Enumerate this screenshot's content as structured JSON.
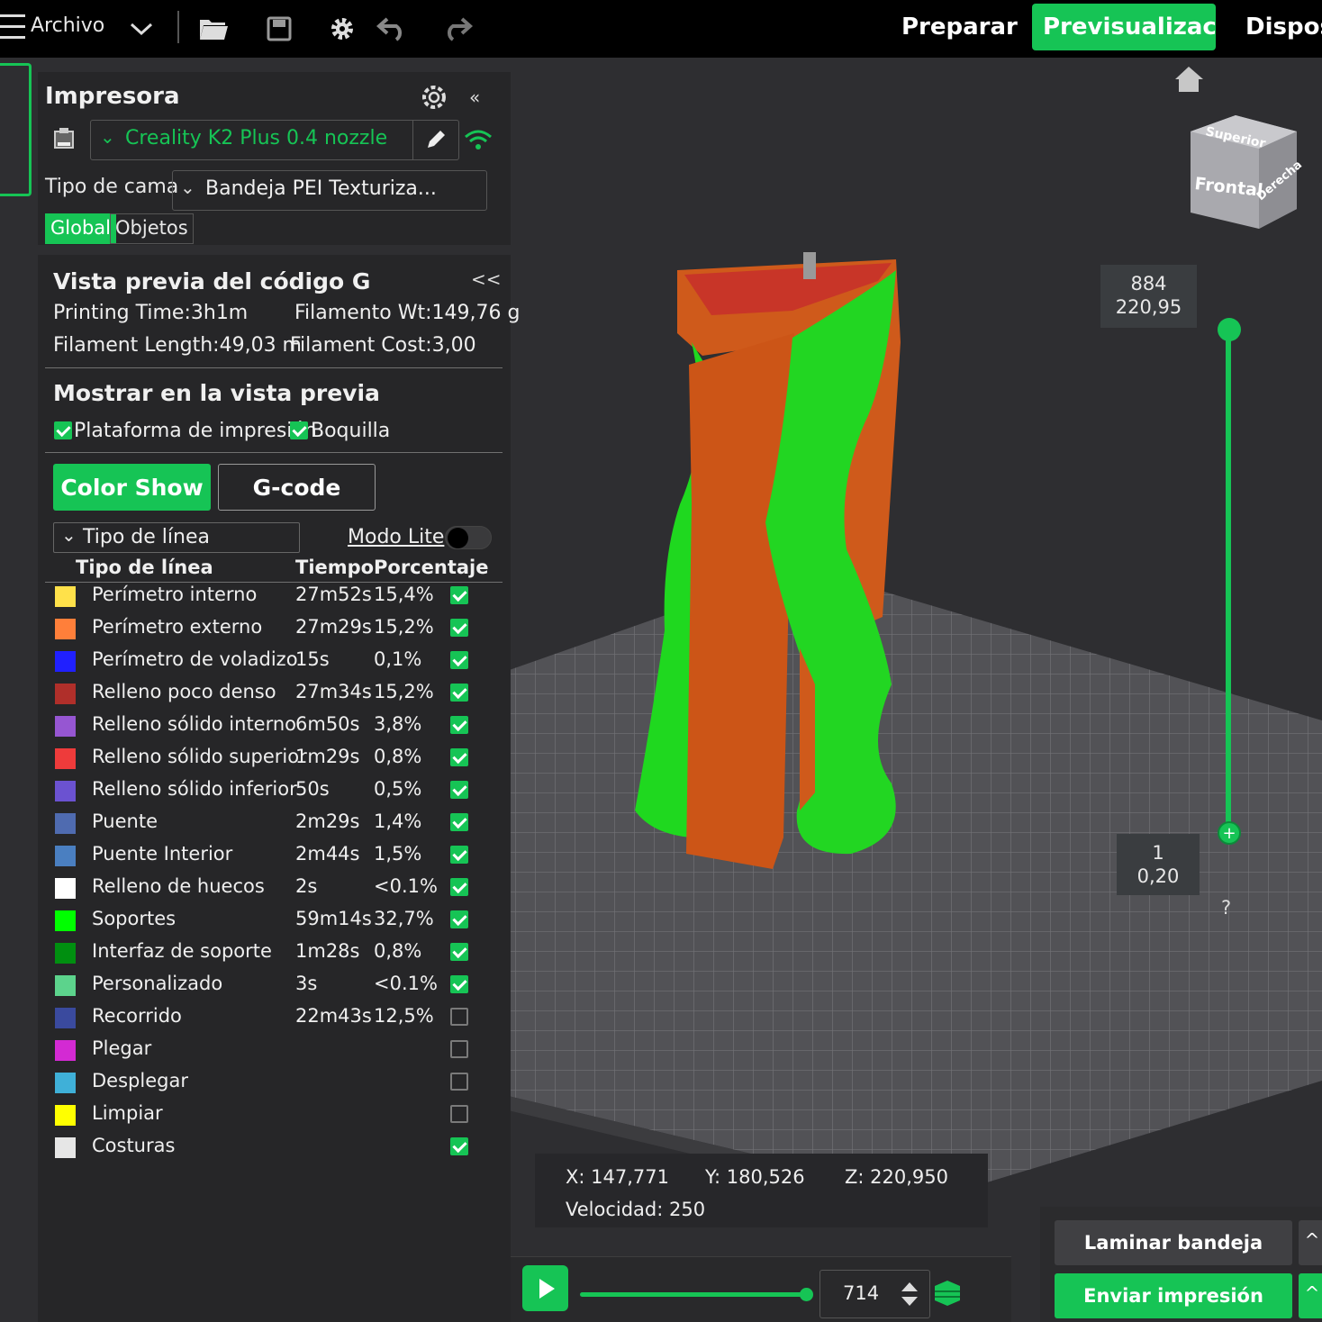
{
  "topbar": {
    "archivo": "Archivo",
    "tabs": [
      "Preparar",
      "Previsualización",
      "Dispositivo"
    ],
    "active_tab": "Previsualización"
  },
  "printer": {
    "title": "Impresora",
    "model": "Creality K2 Plus 0.4 nozzle",
    "bed_label": "Tipo de cama",
    "bed_value": "Bandeja PEI Texturiza...",
    "scope_tabs": [
      "Global",
      "Objetos"
    ]
  },
  "gcode": {
    "title": "Vista previa del código G",
    "collapse": "<<",
    "printing_time": "Printing Time:3h1m",
    "filament_wt": "Filamento Wt:149,76 g",
    "filament_length": "Filament Length:49,03 m",
    "filament_cost": "Filament Cost:3,00",
    "show_title": "Mostrar en la vista previa",
    "show_platform": "Plataforma de impresión",
    "show_nozzle": "Boquilla",
    "btn_color_show": "Color Show",
    "btn_gcode": "G-code",
    "line_type_combo": "Tipo de línea",
    "lite_mode": "Modo Lite",
    "headers": [
      "Tipo de línea",
      "Tiempo",
      "Porcentaje"
    ],
    "legend": [
      {
        "name": "Perímetro interno",
        "time": "27m52s",
        "pct": "15,4%",
        "color": "#ffe14a",
        "checked": true
      },
      {
        "name": "Perímetro externo",
        "time": "27m29s",
        "pct": "15,2%",
        "color": "#ff7f3a",
        "checked": true
      },
      {
        "name": "Perímetro de voladizo",
        "time": "15s",
        "pct": "0,1%",
        "color": "#2020ff",
        "checked": true
      },
      {
        "name": "Relleno poco denso",
        "time": "27m34s",
        "pct": "15,2%",
        "color": "#b02f2a",
        "checked": true
      },
      {
        "name": "Relleno sólido interno",
        "time": "6m50s",
        "pct": "3,8%",
        "color": "#9656d2",
        "checked": true
      },
      {
        "name": "Relleno sólido superior",
        "time": "1m29s",
        "pct": "0,8%",
        "color": "#ee3b3b",
        "checked": true
      },
      {
        "name": "Relleno sólido inferior",
        "time": "50s",
        "pct": "0,5%",
        "color": "#6b52d1",
        "checked": true
      },
      {
        "name": "Puente",
        "time": "2m29s",
        "pct": "1,4%",
        "color": "#4f6bb0",
        "checked": true
      },
      {
        "name": "Puente Interior",
        "time": "2m44s",
        "pct": "1,5%",
        "color": "#4a7fc1",
        "checked": true
      },
      {
        "name": "Relleno de huecos",
        "time": "2s",
        "pct": "<0.1%",
        "color": "#ffffff",
        "checked": true
      },
      {
        "name": "Soportes",
        "time": "59m14s",
        "pct": "32,7%",
        "color": "#00ff00",
        "checked": true
      },
      {
        "name": "Interfaz de soporte",
        "time": "1m28s",
        "pct": "0,8%",
        "color": "#008f10",
        "checked": true
      },
      {
        "name": "Personalizado",
        "time": "3s",
        "pct": "<0.1%",
        "color": "#5cd38c",
        "checked": true
      },
      {
        "name": "Recorrido",
        "time": "22m43s",
        "pct": "12,5%",
        "color": "#3a4a9e",
        "checked": false
      },
      {
        "name": "Plegar",
        "time": "",
        "pct": "",
        "color": "#d32ad3",
        "checked": false
      },
      {
        "name": "Desplegar",
        "time": "",
        "pct": "",
        "color": "#3fb0d8",
        "checked": false
      },
      {
        "name": "Limpiar",
        "time": "",
        "pct": "",
        "color": "#ffff00",
        "checked": false
      },
      {
        "name": "Costuras",
        "time": "",
        "pct": "",
        "color": "#e6e6e6",
        "checked": true
      }
    ]
  },
  "viewport": {
    "cube_top": "Superior",
    "cube_front": "Frontal",
    "cube_right": "Derecha",
    "layer_top": "884",
    "height_top": "220,95",
    "layer_bottom": "1",
    "height_bottom": "0,20",
    "help": "?",
    "x": "X: 147,771",
    "y": "Y: 180,526",
    "z": "Z: 220,950",
    "speed": "Velocidad: 250",
    "move_value": "714",
    "progress": 1.0
  },
  "actions": {
    "slice": "Laminar bandeja",
    "send": "Enviar impresión"
  }
}
